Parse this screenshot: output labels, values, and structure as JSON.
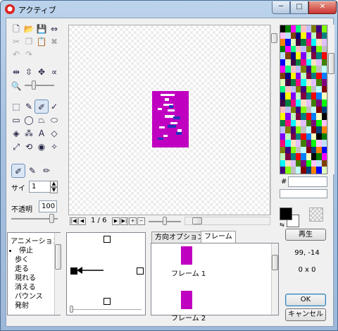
{
  "window": {
    "title": "アクティブ",
    "min_glyph": "─",
    "max_glyph": "□",
    "close_glyph": "✕",
    "app_glyph": "●"
  },
  "tools": {
    "row1": [
      {
        "icon": "new-file-icon",
        "glyph": "🗋"
      },
      {
        "icon": "open-folder-icon",
        "glyph": "📂"
      },
      {
        "icon": "save-icon",
        "glyph": "💾"
      },
      {
        "icon": "import-icon",
        "glyph": "⇔"
      }
    ],
    "row2": [
      {
        "icon": "cut-icon",
        "glyph": "✂"
      },
      {
        "icon": "copy-icon",
        "glyph": "❐"
      },
      {
        "icon": "paste-icon",
        "glyph": "📋"
      },
      {
        "icon": "delete-icon",
        "glyph": "✖"
      }
    ],
    "row3": [
      {
        "icon": "undo-icon",
        "glyph": "↶"
      },
      {
        "icon": "redo-icon",
        "glyph": "↷"
      }
    ],
    "row4": [
      {
        "icon": "flip-horizontal-icon",
        "glyph": "⇹"
      },
      {
        "icon": "flip-vertical-icon",
        "glyph": "⇳"
      },
      {
        "icon": "move-icon",
        "glyph": "✥"
      },
      {
        "icon": "rotate-icon",
        "glyph": "∝"
      }
    ],
    "row5": [
      {
        "icon": "zoom-icon",
        "glyph": "🔍"
      }
    ],
    "grid": [
      {
        "icon": "select-rect-icon",
        "glyph": "⬚"
      },
      {
        "icon": "eyedropper-icon",
        "glyph": "✎"
      },
      {
        "icon": "pencil-icon",
        "glyph": "✐"
      },
      {
        "icon": "brush-icon",
        "glyph": "✓"
      },
      {
        "icon": "rectangle-icon",
        "glyph": "▭"
      },
      {
        "icon": "ellipse-icon",
        "glyph": "◯"
      },
      {
        "icon": "polygon-icon",
        "glyph": "⏢"
      },
      {
        "icon": "lasso-icon",
        "glyph": "⬭"
      },
      {
        "icon": "fill-icon",
        "glyph": "◈"
      },
      {
        "icon": "spray-icon",
        "glyph": "⁂"
      },
      {
        "icon": "text-icon",
        "glyph": "A"
      },
      {
        "icon": "eraser-icon",
        "glyph": "◇"
      },
      {
        "icon": "line-icon",
        "glyph": "⤢"
      },
      {
        "icon": "rotate-tool-icon",
        "glyph": "⟲"
      },
      {
        "icon": "eye-icon",
        "glyph": "◉"
      },
      {
        "icon": "sparkle-icon",
        "glyph": "✧"
      }
    ],
    "brush": [
      {
        "icon": "brush-size-large-icon",
        "glyph": "✐"
      },
      {
        "icon": "brush-size-medium-icon",
        "glyph": "✎"
      },
      {
        "icon": "brush-size-small-icon",
        "glyph": "✏"
      }
    ]
  },
  "size": {
    "label": "サイ",
    "value": "1"
  },
  "opacity": {
    "label": "不透明",
    "value": "100"
  },
  "nav": {
    "first": "|◀",
    "prev": "◀",
    "counter": "1 / 6",
    "next": "▶",
    "last": "▶|",
    "add": "+",
    "remove": "−"
  },
  "color": {
    "hash_label": "#",
    "hex_value": ""
  },
  "animation": {
    "header": "アニメーション",
    "items": [
      {
        "label": "停止",
        "selected": true
      },
      {
        "label": "歩く"
      },
      {
        "label": "走る"
      },
      {
        "label": "現れる"
      },
      {
        "label": "消える"
      },
      {
        "label": "バウンス"
      },
      {
        "label": "発射"
      }
    ]
  },
  "tabs": [
    {
      "label": "方向オプション"
    },
    {
      "label": "フレーム",
      "active": true
    }
  ],
  "frames": [
    {
      "label": "フレーム 1"
    },
    {
      "label": "フレーム 2"
    }
  ],
  "buttons": {
    "play": "再生",
    "ok": "OK",
    "cancel": "キャンセル"
  },
  "readouts": {
    "hotspot": "99, -14",
    "size": "0 x 0"
  },
  "palette_colors": [
    "#000000",
    "#800000",
    "#008000",
    "#808000",
    "#000080",
    "#800080",
    "#008080",
    "#c0c0c0",
    "#808080",
    "#ff0000",
    "#00ff00",
    "#ffff00",
    "#0000ff",
    "#ff00ff",
    "#00ffff",
    "#ffffff"
  ]
}
